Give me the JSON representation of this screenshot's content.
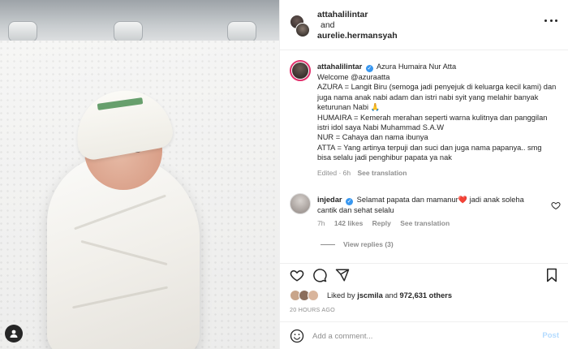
{
  "header": {
    "user1": "attahalilintar",
    "joiner": "and",
    "user2": "aurelie.hermansyah"
  },
  "caption": {
    "username": "attahalilintar",
    "verified": true,
    "lines": [
      "Azura Humaira Nur Atta",
      "Welcome @azuraatta",
      "AZURA = Langit Biru (semoga jadi penyejuk di keluarga kecil kami) dan juga nama anak nabi adam dan istri nabi syit yang melahir banyak keturunan Nabi 🙏",
      "HUMAIRA = Kemerah merahan seperti warna kulitnya dan panggilan istri idol saya Nabi Muhammad S.A.W",
      "NUR = Cahaya dan nama ibunya",
      "ATTA = Yang artinya terpuji dan suci dan juga nama papanya.. smg bisa selalu jadi penghibur papata ya nak"
    ],
    "edited": "Edited · 6h",
    "see_translation": "See translation"
  },
  "comment": {
    "username": "injedar",
    "verified": true,
    "text_before": "Selamat papata dan mamanur",
    "heart": "❤️",
    "text_after": " jadi anak soleha cantik dan sehat selalu",
    "time": "7h",
    "likes": "142 likes",
    "reply": "Reply",
    "see_translation": "See translation",
    "view_replies": "View replies (3)"
  },
  "likes": {
    "prefix": "Liked by",
    "user": "jscmila",
    "and": "and",
    "count": "972,631 others",
    "avatar_colors": [
      "#c8a58a",
      "#8b6e5c",
      "#d9b59c"
    ]
  },
  "time_ago": "20 HOURS AGO",
  "add_comment": {
    "placeholder": "Add a comment...",
    "post": "Post"
  },
  "icons": [
    "more-icon",
    "verified-icon",
    "heart-icon",
    "comment-icon",
    "share-icon",
    "bookmark-icon",
    "emoji-icon",
    "user-tag-icon"
  ]
}
